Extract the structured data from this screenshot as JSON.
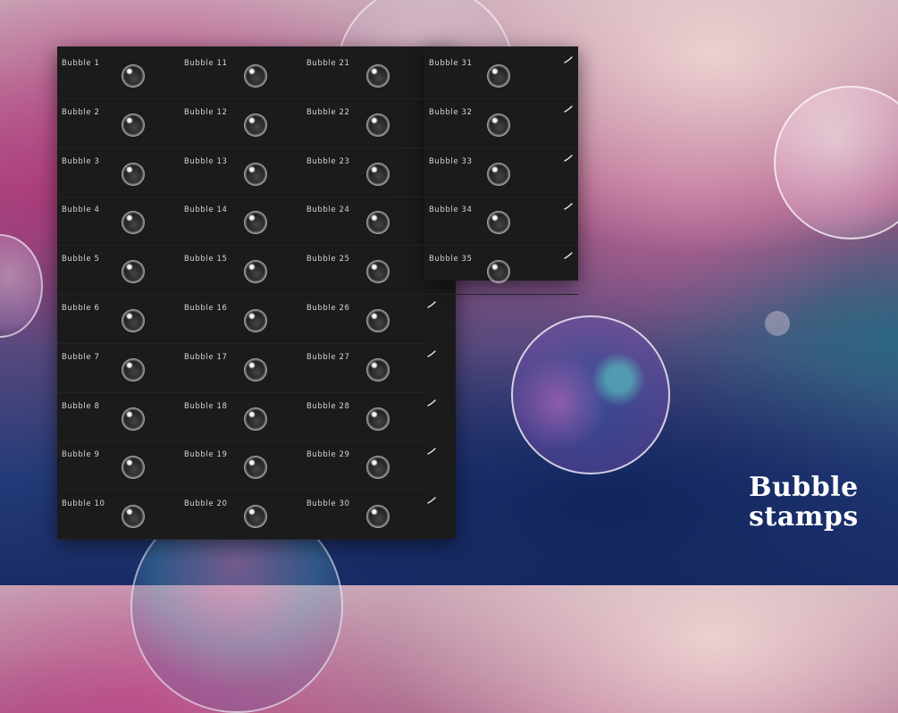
{
  "title": {
    "line1": "Bubble",
    "line2": "stamps"
  },
  "brush_icon": "brush-stroke-icon",
  "columns": [
    {
      "brushes": [
        "Bubble 1",
        "Bubble 2",
        "Bubble 3",
        "Bubble 4",
        "Bubble 5",
        "Bubble 6",
        "Bubble 7",
        "Bubble 8",
        "Bubble 9",
        "Bubble 10"
      ]
    },
    {
      "brushes": [
        "Bubble 11",
        "Bubble 12",
        "Bubble 13",
        "Bubble 14",
        "Bubble 15",
        "Bubble 16",
        "Bubble 17",
        "Bubble 18",
        "Bubble 19",
        "Bubble 20"
      ]
    },
    {
      "brushes": [
        "Bubble 21",
        "Bubble 22",
        "Bubble 23",
        "Bubble 24",
        "Bubble 25",
        "Bubble 26",
        "Bubble 27",
        "Bubble 28",
        "Bubble 29",
        "Bubble 30"
      ]
    },
    {
      "brushes": [
        "Bubble 31",
        "Bubble 32",
        "Bubble 33",
        "Bubble 34",
        "Bubble 35"
      ]
    }
  ]
}
